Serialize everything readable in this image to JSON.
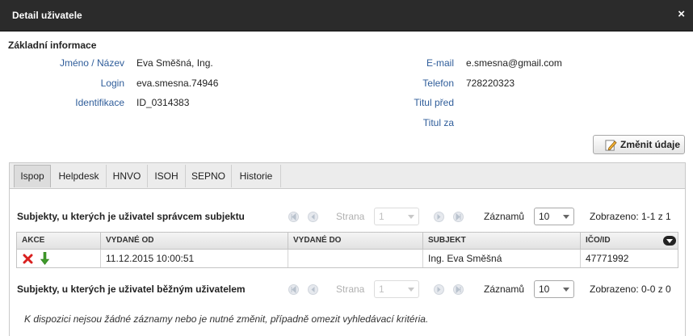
{
  "dialog": {
    "title": "Detail uživatele",
    "close_label": "×"
  },
  "basic": {
    "title": "Základní informace",
    "left": [
      {
        "label": "Jméno / Název",
        "value": "Eva Směšná, Ing."
      },
      {
        "label": "Login",
        "value": "eva.smesna.74946"
      },
      {
        "label": "Identifikace",
        "value": "ID_0314383"
      }
    ],
    "right": [
      {
        "label": "E-mail",
        "value": "e.smesna@gmail.com"
      },
      {
        "label": "Telefon",
        "value": "728220323"
      },
      {
        "label": "Titul před",
        "value": ""
      },
      {
        "label": "Titul za",
        "value": ""
      }
    ]
  },
  "change_button": {
    "label": "Změnit údaje",
    "icon": "pencil-icon"
  },
  "tabs": [
    {
      "label": "Ispop",
      "active": true
    },
    {
      "label": "Helpdesk"
    },
    {
      "label": "HNVO"
    },
    {
      "label": "ISOH"
    },
    {
      "label": "SEPNO"
    },
    {
      "label": "Historie"
    }
  ],
  "grid1": {
    "title": "Subjekty, u kterých je uživatel správcem subjektu",
    "pager": {
      "page_label": "Strana",
      "page_value": "1",
      "records_label": "Záznamů",
      "records_value": "10",
      "shown": "Zobrazeno: 1-1 z 1"
    },
    "columns": [
      "AKCE",
      "VYDANÉ OD",
      "VYDANÉ DO",
      "SUBJEKT",
      "IČO/ID"
    ],
    "rows": [
      {
        "vydane_od": "11.12.2015 10:00:51",
        "vydane_do": "",
        "subjekt": "Ing. Eva Směšná",
        "ico": "47771992"
      }
    ]
  },
  "grid2": {
    "title": "Subjekty, u kterých je uživatel běžným uživatelem",
    "pager": {
      "page_label": "Strana",
      "page_value": "1",
      "records_label": "Záznamů",
      "records_value": "10",
      "shown": "Zobrazeno: 0-0 z 0"
    },
    "empty_message": "K dispozici nejsou žádné záznamy nebo je nutné změnit, případně omezit vyhledávací kritéria."
  },
  "colors": {
    "titlebar": "#2b2b2b",
    "label": "#2f5d9a",
    "delete": "#d9201f",
    "download": "#3f9a2a"
  }
}
